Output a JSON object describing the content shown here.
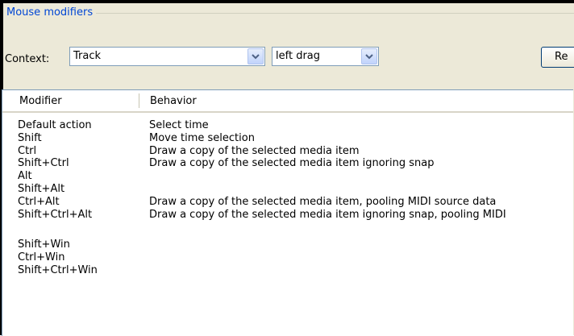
{
  "group": {
    "title": "Mouse modifiers"
  },
  "context": {
    "label": "Context:",
    "primary_value": "Track",
    "secondary_value": "left drag",
    "reset_label": "Re"
  },
  "table": {
    "columns": [
      "Modifier",
      "Behavior"
    ],
    "rows": [
      {
        "modifier": "Default action",
        "behavior": "Select time"
      },
      {
        "modifier": "Shift",
        "behavior": "Move time selection"
      },
      {
        "modifier": "Ctrl",
        "behavior": "Draw a copy of the selected media item"
      },
      {
        "modifier": "Shift+Ctrl",
        "behavior": "Draw a copy of the selected media item ignoring snap"
      },
      {
        "modifier": "Alt",
        "behavior": ""
      },
      {
        "modifier": "Shift+Alt",
        "behavior": ""
      },
      {
        "modifier": "Ctrl+Alt",
        "behavior": "Draw a copy of the selected media item, pooling MIDI source data"
      },
      {
        "modifier": "Shift+Ctrl+Alt",
        "behavior": "Draw a copy of the selected media item ignoring snap, pooling MIDI"
      },
      {
        "modifier": "",
        "behavior": ""
      },
      {
        "modifier": "Shift+Win",
        "behavior": ""
      },
      {
        "modifier": "Ctrl+Win",
        "behavior": ""
      },
      {
        "modifier": "Shift+Ctrl+Win",
        "behavior": ""
      }
    ]
  },
  "icons": {
    "dropdown": "chevron-down-icon"
  },
  "colors": {
    "group_title": "#0046d5",
    "panel": "#ece9d8",
    "combo_border": "#7f9db9"
  }
}
